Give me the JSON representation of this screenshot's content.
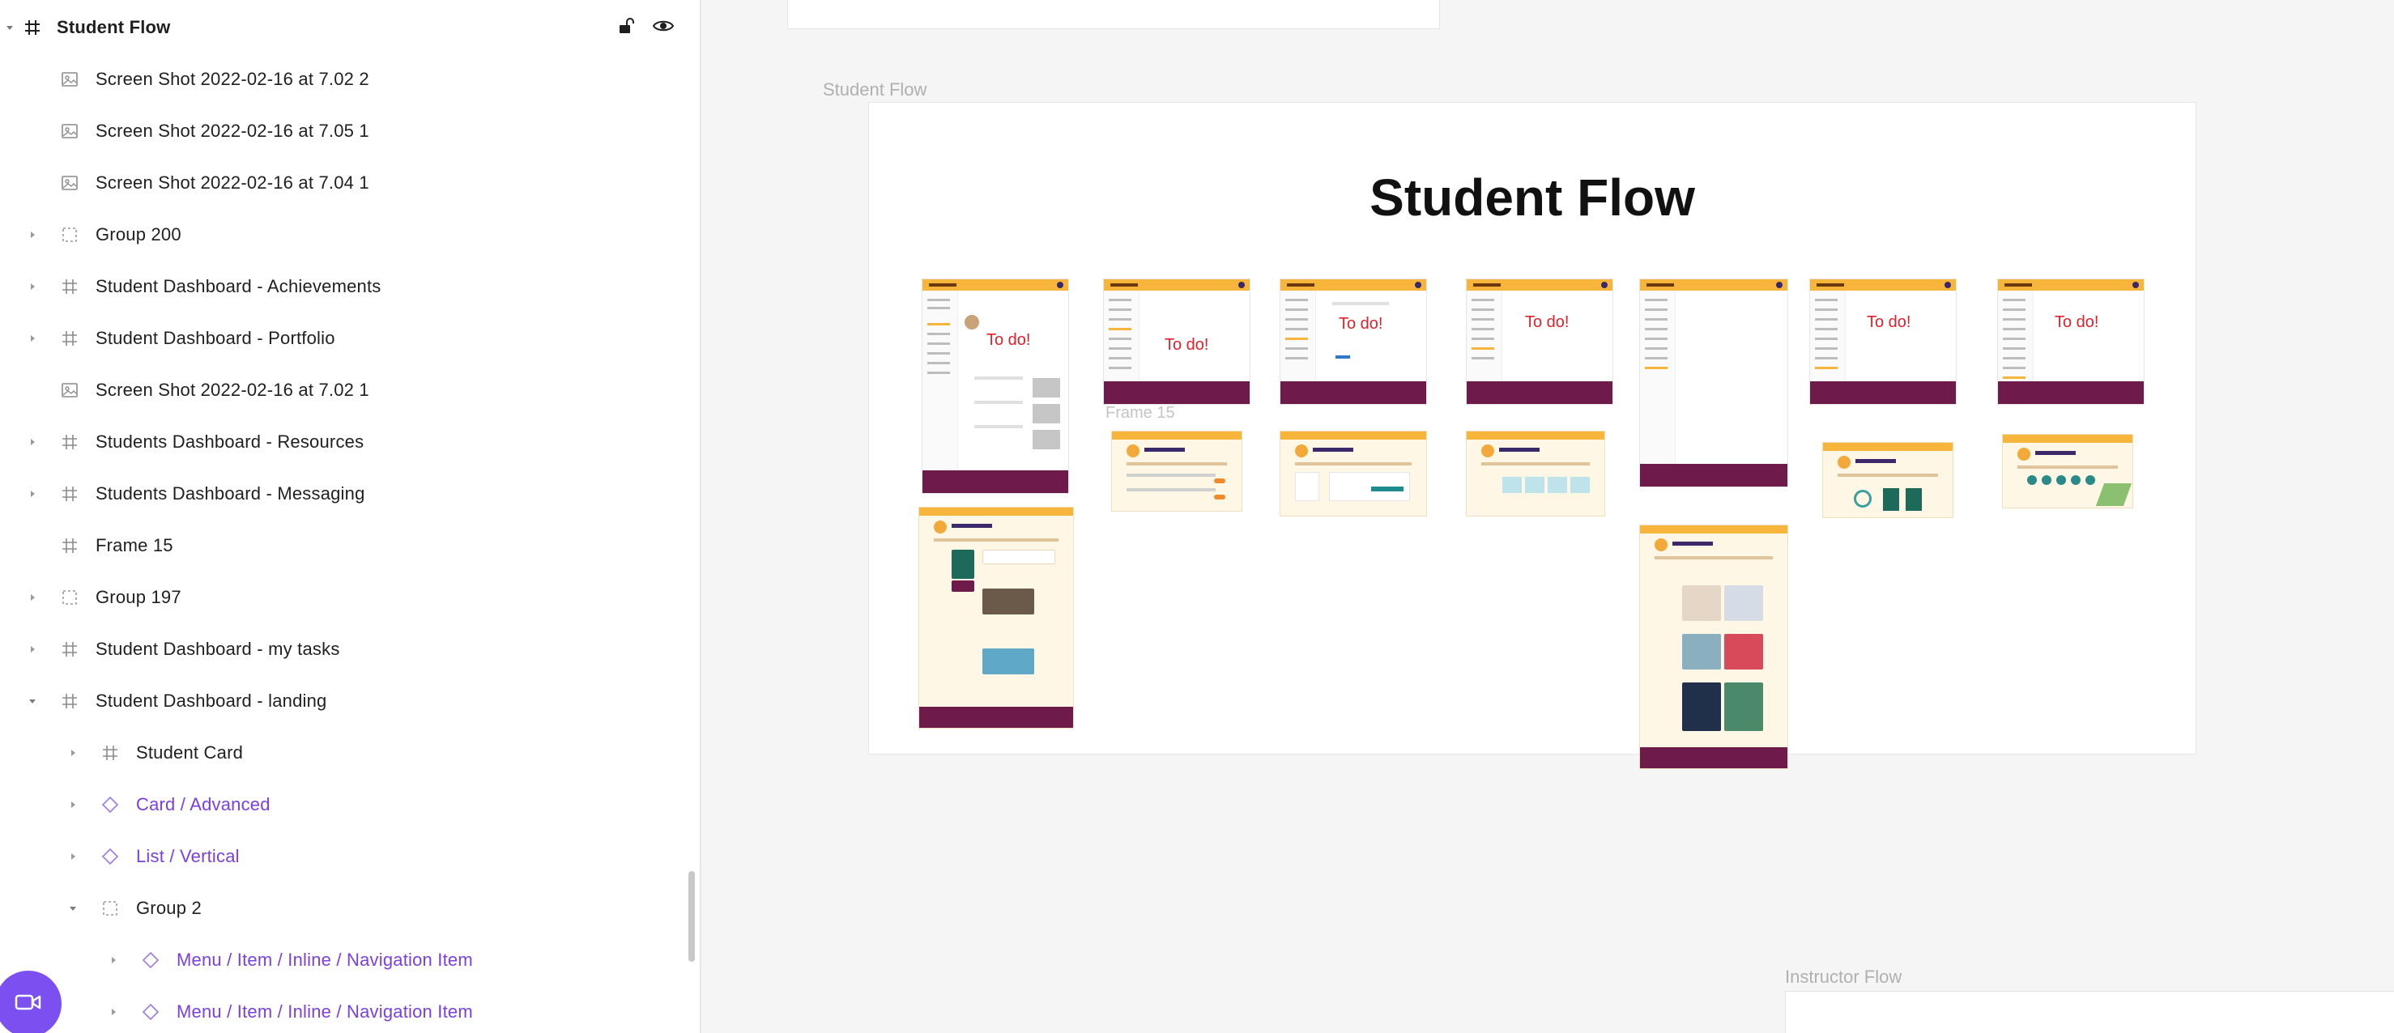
{
  "layers": {
    "top": {
      "label": "Student Flow",
      "icon": "frame-hash-icon",
      "lock_icon": "unlock-icon",
      "visibility_icon": "eye-icon"
    },
    "items": [
      {
        "label": "Screen Shot 2022-02-16 at 7.02 2",
        "icon": "image-icon",
        "expandable": false,
        "component": false
      },
      {
        "label": "Screen Shot 2022-02-16 at 7.05 1",
        "icon": "image-icon",
        "expandable": false,
        "component": false
      },
      {
        "label": "Screen Shot 2022-02-16 at 7.04 1",
        "icon": "image-icon",
        "expandable": false,
        "component": false
      },
      {
        "label": "Group 200",
        "icon": "group-icon",
        "expandable": true,
        "component": false
      },
      {
        "label": "Student Dashboard - Achievements",
        "icon": "frame-hash-icon",
        "expandable": true,
        "component": false
      },
      {
        "label": "Student Dashboard - Portfolio",
        "icon": "frame-hash-icon",
        "expandable": true,
        "component": false
      },
      {
        "label": "Screen Shot 2022-02-16 at 7.02 1",
        "icon": "image-icon",
        "expandable": false,
        "component": false
      },
      {
        "label": "Students Dashboard - Resources",
        "icon": "frame-hash-icon",
        "expandable": true,
        "component": false
      },
      {
        "label": "Students Dashboard - Messaging",
        "icon": "frame-hash-icon",
        "expandable": true,
        "component": false
      },
      {
        "label": "Frame 15",
        "icon": "frame-hash-icon",
        "expandable": false,
        "component": false
      },
      {
        "label": "Group 197",
        "icon": "group-icon",
        "expandable": true,
        "component": false
      },
      {
        "label": "Student Dashboard - my tasks",
        "icon": "frame-hash-icon",
        "expandable": true,
        "component": false
      },
      {
        "label": "Student Dashboard - landing",
        "icon": "frame-hash-icon",
        "expandable": true,
        "expanded": true,
        "component": false
      },
      {
        "label": "Student Card",
        "icon": "frame-hash-icon",
        "expandable": true,
        "component": false
      },
      {
        "label": "Card / Advanced",
        "icon": "component-instance-icon",
        "expandable": true,
        "component": true
      },
      {
        "label": "List / Vertical",
        "icon": "component-instance-icon",
        "expandable": true,
        "component": true
      },
      {
        "label": "Group 2",
        "icon": "group-icon",
        "expandable": true,
        "expanded": true,
        "component": false
      },
      {
        "label": "Menu / Item / Inline / Navigation Item",
        "icon": "component-instance-icon",
        "expandable": true,
        "component": true
      },
      {
        "label": "Menu / Item / Inline / Navigation Item",
        "icon": "component-instance-icon",
        "expandable": true,
        "component": true
      }
    ]
  },
  "canvas": {
    "frame_labels": {
      "student_flow": "Student Flow",
      "instructor_flow": "Instructor Flow",
      "frame_15": "Frame 15"
    },
    "main_title": "Student Flow",
    "todo_text": "To do!"
  },
  "colors": {
    "component_purple": "#7b3fe4",
    "header_orange": "#f7b53b",
    "footer_maroon": "#6e1a4a",
    "todo_red": "#e0202a",
    "record_button": "#7b4ff0"
  },
  "record_button_icon": "video-camera-icon"
}
